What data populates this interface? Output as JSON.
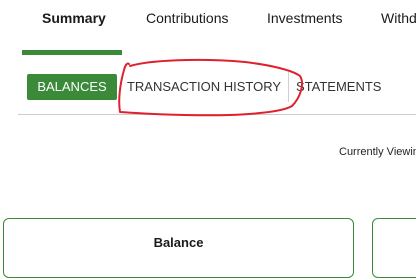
{
  "top_tabs": [
    {
      "label": "Summary",
      "active": true
    },
    {
      "label": "Contributions",
      "active": false
    },
    {
      "label": "Investments",
      "active": false
    },
    {
      "label": "Withdr",
      "active": false
    }
  ],
  "sub_tabs": [
    {
      "label": "BALANCES",
      "active": true
    },
    {
      "label": "TRANSACTION HISTORY",
      "active": false
    },
    {
      "label": "STATEMENTS",
      "active": false
    }
  ],
  "currently_viewing_label": "Currently Viewin",
  "cards": [
    {
      "title": "Balance"
    }
  ],
  "colors": {
    "accent_green": "#3a8a3a",
    "annotation_red": "#e0202e"
  }
}
